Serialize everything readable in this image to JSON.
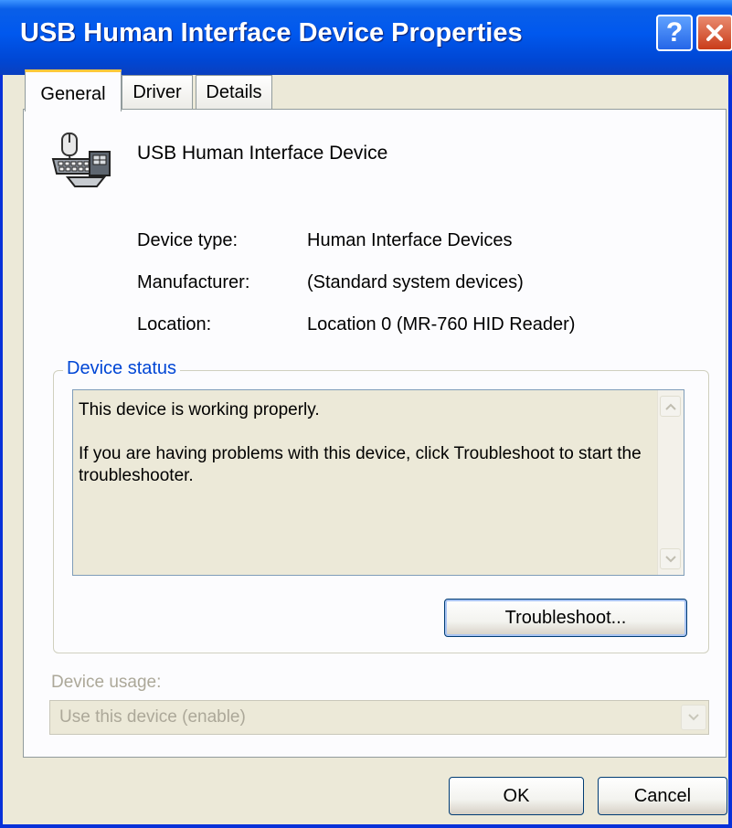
{
  "window": {
    "title": "USB Human Interface Device Properties",
    "help_glyph": "?",
    "accent_color": "#0058EE"
  },
  "tabs": [
    {
      "label": "General",
      "selected": true
    },
    {
      "label": "Driver",
      "selected": false
    },
    {
      "label": "Details",
      "selected": false
    }
  ],
  "device": {
    "icon": "hid-device-icon",
    "name": "USB Human Interface Device"
  },
  "properties": [
    {
      "label": "Device type:",
      "value": "Human Interface Devices"
    },
    {
      "label": "Manufacturer:",
      "value": "(Standard system devices)"
    },
    {
      "label": "Location:",
      "value": "Location 0 (MR-760 HID Reader)"
    }
  ],
  "status": {
    "legend": "Device status",
    "line1": "This device is working properly.",
    "line2": "If you are having problems with this device, click Troubleshoot to start the troubleshooter.",
    "troubleshoot_label": "Troubleshoot..."
  },
  "usage": {
    "label": "Device usage:",
    "selected": "Use this device (enable)",
    "disabled": true
  },
  "footer": {
    "ok_label": "OK",
    "cancel_label": "Cancel"
  }
}
